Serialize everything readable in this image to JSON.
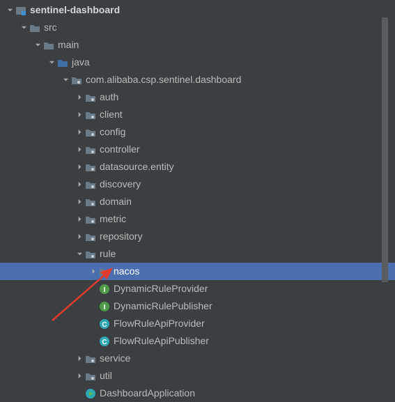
{
  "tree": [
    {
      "depth": 0,
      "arrow": "down",
      "icon": "module",
      "label": "sentinel-dashboard",
      "root": true
    },
    {
      "depth": 1,
      "arrow": "down",
      "icon": "folder",
      "label": "src"
    },
    {
      "depth": 2,
      "arrow": "down",
      "icon": "folder",
      "label": "main"
    },
    {
      "depth": 3,
      "arrow": "down",
      "icon": "folder-src",
      "label": "java"
    },
    {
      "depth": 4,
      "arrow": "down",
      "icon": "package",
      "label": "com.alibaba.csp.sentinel.dashboard"
    },
    {
      "depth": 5,
      "arrow": "right",
      "icon": "package",
      "label": "auth"
    },
    {
      "depth": 5,
      "arrow": "right",
      "icon": "package",
      "label": "client"
    },
    {
      "depth": 5,
      "arrow": "right",
      "icon": "package",
      "label": "config"
    },
    {
      "depth": 5,
      "arrow": "right",
      "icon": "package",
      "label": "controller"
    },
    {
      "depth": 5,
      "arrow": "right",
      "icon": "package",
      "label": "datasource.entity"
    },
    {
      "depth": 5,
      "arrow": "right",
      "icon": "package",
      "label": "discovery"
    },
    {
      "depth": 5,
      "arrow": "right",
      "icon": "package",
      "label": "domain"
    },
    {
      "depth": 5,
      "arrow": "right",
      "icon": "package",
      "label": "metric"
    },
    {
      "depth": 5,
      "arrow": "right",
      "icon": "package",
      "label": "repository"
    },
    {
      "depth": 5,
      "arrow": "down",
      "icon": "package",
      "label": "rule"
    },
    {
      "depth": 6,
      "arrow": "right",
      "icon": "package",
      "label": "nacos",
      "selected": true
    },
    {
      "depth": 6,
      "arrow": "none",
      "icon": "iface",
      "label": "DynamicRuleProvider"
    },
    {
      "depth": 6,
      "arrow": "none",
      "icon": "iface",
      "label": "DynamicRulePublisher"
    },
    {
      "depth": 6,
      "arrow": "none",
      "icon": "class",
      "label": "FlowRuleApiProvider"
    },
    {
      "depth": 6,
      "arrow": "none",
      "icon": "class",
      "label": "FlowRuleApiPublisher"
    },
    {
      "depth": 5,
      "arrow": "right",
      "icon": "package",
      "label": "service"
    },
    {
      "depth": 5,
      "arrow": "right",
      "icon": "package",
      "label": "util"
    },
    {
      "depth": 5,
      "arrow": "none",
      "icon": "class-run",
      "label": "DashboardApplication"
    }
  ],
  "indentPx": 20,
  "baseIndentPx": 6
}
